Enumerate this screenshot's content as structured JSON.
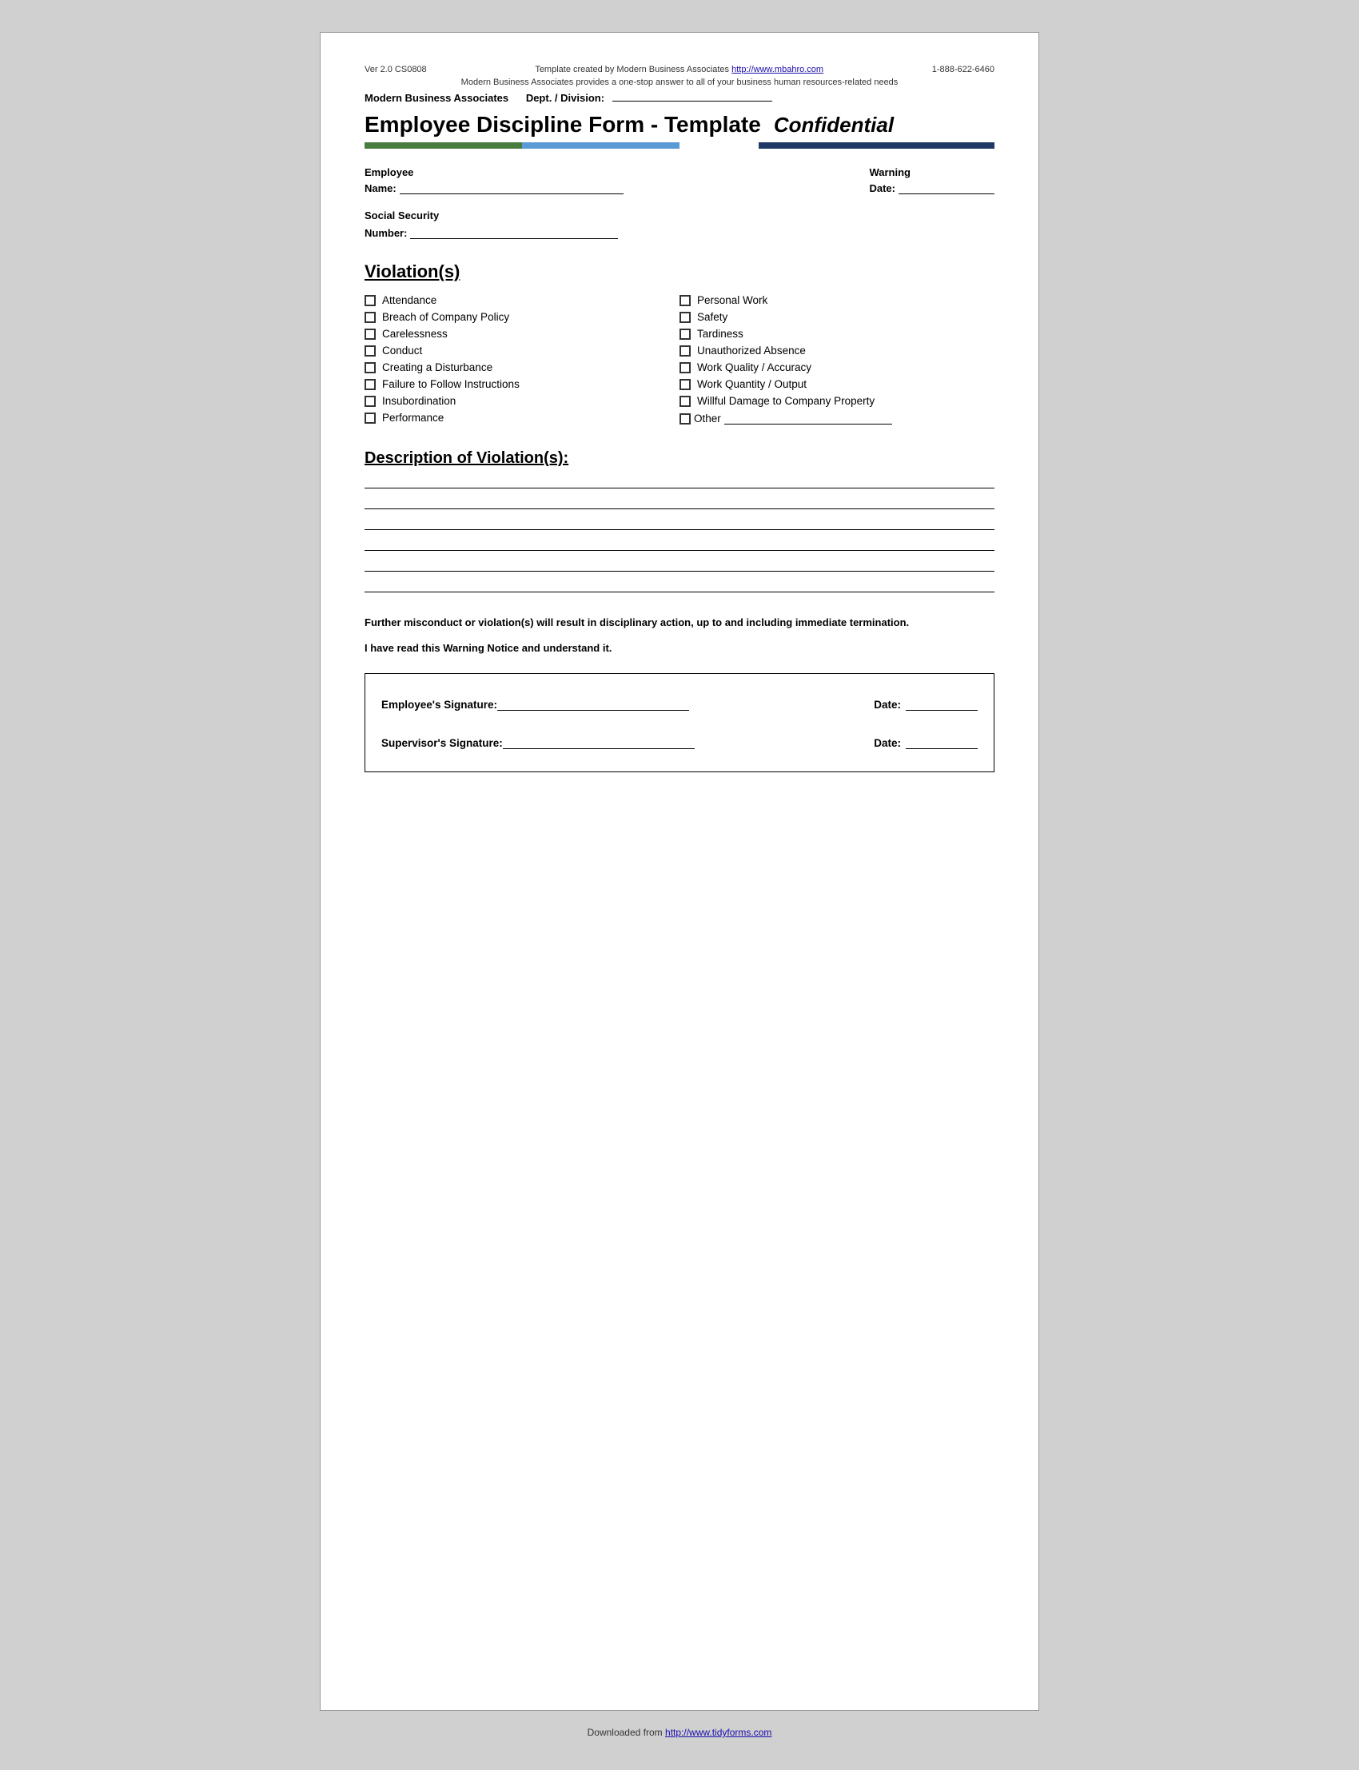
{
  "header": {
    "version": "Ver 2.0 CS0808",
    "template_text": "Template created by Modern Business Associates",
    "website_url": "http://www.mbahro.com",
    "phone": "1-888-622-6460",
    "tagline": "Modern Business Associates provides a one-stop answer to all of your business human resources-related needs",
    "company_name": "Modern Business Associates",
    "dept_label": "Dept. / Division:"
  },
  "title": {
    "main": "Employee Discipline Form - Template",
    "confidential": "Confidential"
  },
  "fields": {
    "employee_name_label": "Employee",
    "employee_name_sublabel": "Name:",
    "warning_date_label": "Warning",
    "warning_date_sublabel": "Date:",
    "ssn_label": "Social Security",
    "ssn_sublabel": "Number:"
  },
  "violations": {
    "title": "Violation(s)",
    "left_items": [
      "Attendance",
      "Breach of Company Policy",
      "Carelessness",
      "Conduct",
      "Creating a Disturbance",
      "Failure to Follow Instructions",
      "Insubordination",
      "Performance"
    ],
    "right_items": [
      "Personal Work",
      "Safety",
      "Tardiness",
      "Unauthorized Absence",
      "Work Quality / Accuracy",
      "Work Quantity / Output",
      "Willful Damage to Company Property"
    ],
    "other_label": "Other"
  },
  "description": {
    "title": "Description of Violation(s):",
    "line_count": 6
  },
  "warnings": {
    "further_misconduct": "Further misconduct or violation(s) will result in disciplinary action, up to and including immediate termination.",
    "read_notice": "I have read this Warning Notice and understand it."
  },
  "signatures": {
    "employee_label": "Employee's Signature:",
    "employee_date_label": "Date:",
    "supervisor_label": "Supervisor's Signature:",
    "supervisor_date_label": "Date:"
  },
  "footer": {
    "text": "Downloaded from",
    "url": "http://www.tidyforms.com"
  },
  "colors": {
    "bar_green": "#4a7c3f",
    "bar_blue_light": "#5b9bd5",
    "bar_blue_dark": "#1f3864",
    "link": "#1a0dab"
  }
}
